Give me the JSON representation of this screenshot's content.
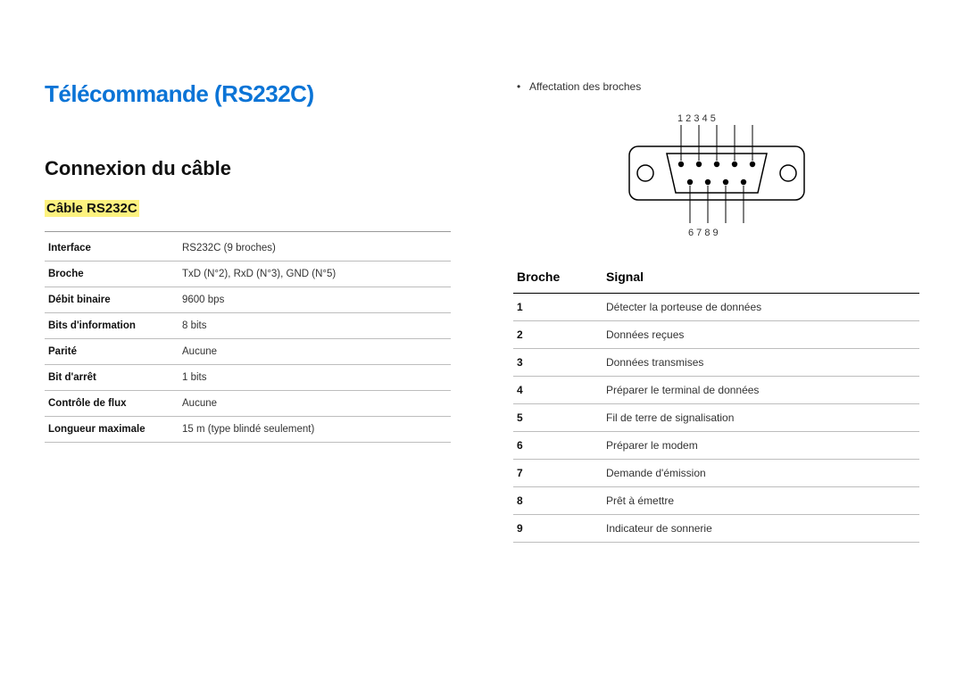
{
  "title": "Télécommande (RS232C)",
  "section_title": "Connexion du câble",
  "subsection_title": "Câble RS232C",
  "cable_spec": [
    {
      "label": "Interface",
      "value": "RS232C (9 broches)"
    },
    {
      "label": "Broche",
      "value": "TxD (N°2), RxD (N°3), GND (N°5)"
    },
    {
      "label": "Débit binaire",
      "value": "9600 bps"
    },
    {
      "label": "Bits d'information",
      "value": "8 bits"
    },
    {
      "label": "Parité",
      "value": "Aucune"
    },
    {
      "label": "Bit d'arrêt",
      "value": "1 bits"
    },
    {
      "label": "Contrôle de flux",
      "value": "Aucune"
    },
    {
      "label": "Longueur maximale",
      "value": "15 m (type blindé seulement)"
    }
  ],
  "pin_bullet": "Affectation des broches",
  "connector_top_labels": "1  2 3 4 5",
  "connector_bottom_labels": "6 7 8 9",
  "pin_table_headers": {
    "pin": "Broche",
    "signal": "Signal"
  },
  "pin_table": [
    {
      "pin": "1",
      "signal": "Détecter la porteuse de données"
    },
    {
      "pin": "2",
      "signal": "Données reçues"
    },
    {
      "pin": "3",
      "signal": "Données transmises"
    },
    {
      "pin": "4",
      "signal": "Préparer le terminal de données"
    },
    {
      "pin": "5",
      "signal": "Fil de terre de signalisation"
    },
    {
      "pin": "6",
      "signal": "Préparer le modem"
    },
    {
      "pin": "7",
      "signal": "Demande d'émission"
    },
    {
      "pin": "8",
      "signal": "Prêt à émettre"
    },
    {
      "pin": "9",
      "signal": "Indicateur de sonnerie"
    }
  ]
}
